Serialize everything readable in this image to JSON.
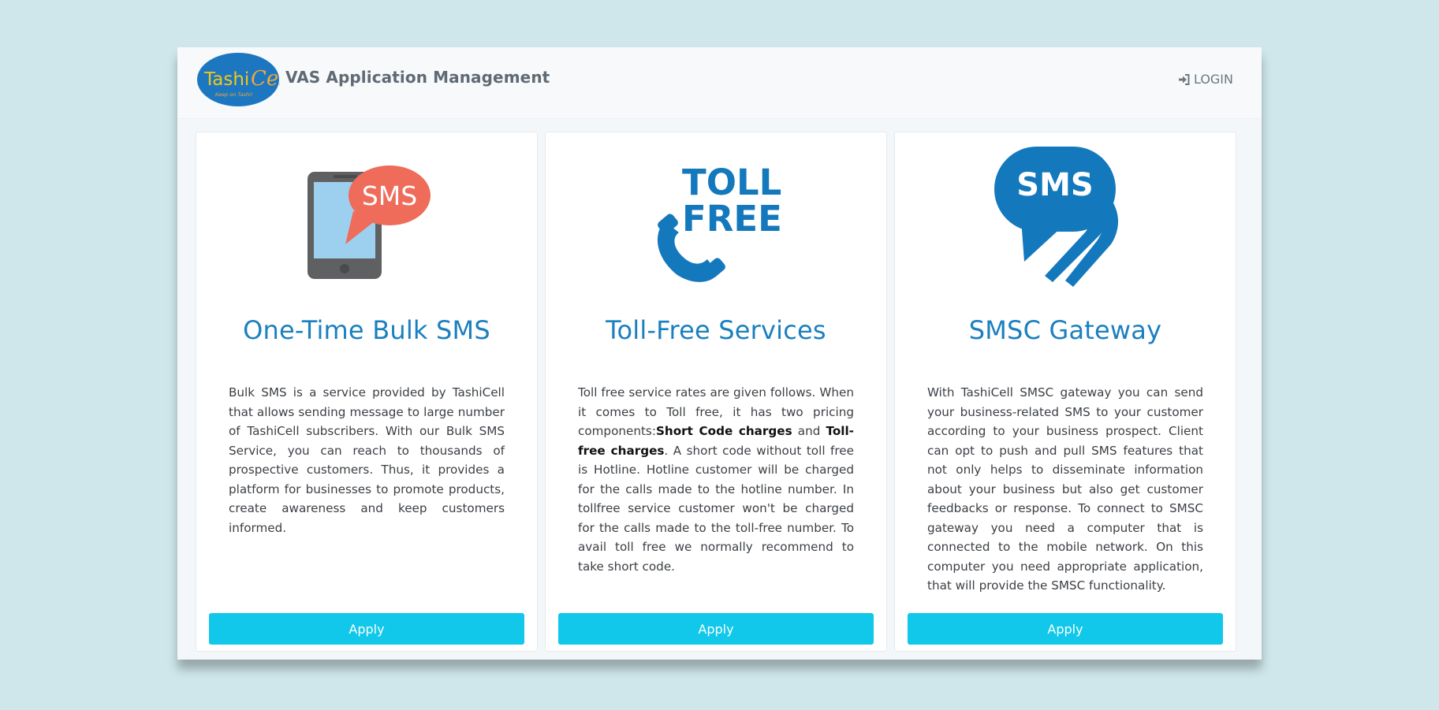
{
  "header": {
    "logo_text": "TashiCell",
    "logo_tagline": "Keep on Tashi!",
    "app_title": "VAS Application Management",
    "login_label": "LOGIN"
  },
  "cards": [
    {
      "icon": "sms-phone-icon",
      "title": "One-Time Bulk SMS",
      "description": "Bulk SMS is a service provided by TashiCell that allows sending message to large number of TashiCell subscribers. With our Bulk SMS Service, you can reach to thousands of prospective customers. Thus, it provides a platform for businesses to promote products, create awareness and keep customers informed.",
      "apply_label": "Apply"
    },
    {
      "icon": "toll-free-phone-icon",
      "title": "Toll-Free Services",
      "description_parts": [
        "Toll free service rates are given follows. When it comes to Toll free, it has two pricing components:",
        "Short Code charges",
        " and ",
        "Toll-free charges",
        ". A short code without toll free is Hotline. Hotline customer will be charged for the calls made to the hotline number. In tollfree service customer won't be charged for the calls made to the toll-free number. To avail toll free we normally recommend to take short code."
      ],
      "apply_label": "Apply"
    },
    {
      "icon": "sms-chat-bubbles-icon",
      "title": "SMSC Gateway",
      "description": "With TashiCell SMSC gateway you can send your business-related SMS to your customer according to your business prospect. Client can opt to push and pull SMS features that not only helps to disseminate information about your business but also get customer feedbacks or response. To connect to SMSC gateway you need a computer that is connected to the mobile network. On this computer you need appropriate application, that will provide the SMSC functionality.",
      "apply_label": "Apply"
    }
  ],
  "icon_text": {
    "sms": "SMS",
    "toll": "TOLL",
    "free": "FREE"
  },
  "colors": {
    "page_background": "#cfe7eb",
    "title_blue": "#1a80bf",
    "apply_button": "#11c7ea",
    "sms_bubble": "#ef6b5a",
    "phone_screen": "#9dd0ef",
    "phone_body": "#5f6062"
  }
}
